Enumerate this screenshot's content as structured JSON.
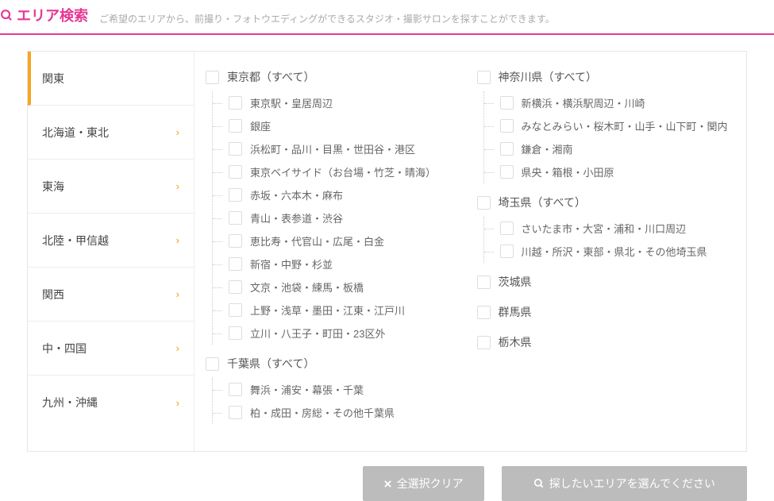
{
  "header": {
    "title": "エリア検索",
    "desc": "ご希望のエリアから、前撮り・フォトウエディングができるスタジオ・撮影サロンを探すことができます。"
  },
  "sidebar": {
    "items": [
      {
        "label": "関東",
        "active": true
      },
      {
        "label": "北海道・東北"
      },
      {
        "label": "東海"
      },
      {
        "label": "北陸・甲信越"
      },
      {
        "label": "関西"
      },
      {
        "label": "中・四国"
      },
      {
        "label": "九州・沖縄"
      }
    ]
  },
  "columns": [
    [
      {
        "label": "東京都（すべて）",
        "children": [
          "東京駅・皇居周辺",
          "銀座",
          "浜松町・品川・目黒・世田谷・港区",
          "東京ベイサイド（お台場・竹芝・晴海）",
          "赤坂・六本木・麻布",
          "青山・表参道・渋谷",
          "恵比寿・代官山・広尾・白金",
          "新宿・中野・杉並",
          "文京・池袋・練馬・板橋",
          "上野・浅草・墨田・江東・江戸川",
          "立川・八王子・町田・23区外"
        ]
      },
      {
        "label": "千葉県（すべて）",
        "children": [
          "舞浜・浦安・幕張・千葉",
          "柏・成田・房総・その他千葉県"
        ]
      }
    ],
    [
      {
        "label": "神奈川県（すべて）",
        "children": [
          "新横浜・横浜駅周辺・川崎",
          "みなとみらい・桜木町・山手・山下町・関内",
          "鎌倉・湘南",
          "県央・箱根・小田原"
        ]
      },
      {
        "label": "埼玉県（すべて）",
        "children": [
          "さいたま市・大宮・浦和・川口周辺",
          "川越・所沢・東部・県北・その他埼玉県"
        ]
      },
      {
        "label": "茨城県"
      },
      {
        "label": "群馬県"
      },
      {
        "label": "栃木県"
      }
    ]
  ],
  "footer": {
    "clear": "全選択クリア",
    "search": "探したいエリアを選んでください"
  }
}
